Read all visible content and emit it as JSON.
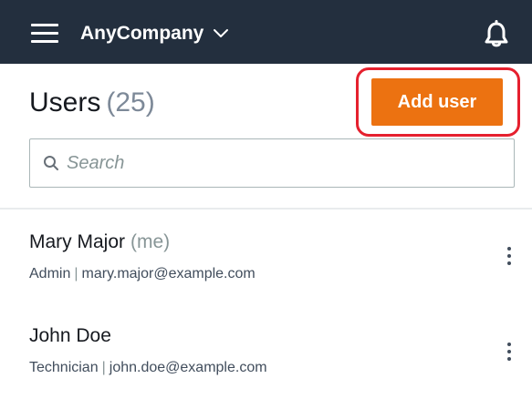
{
  "topbar": {
    "company_name": "AnyCompany",
    "menu_icon": "hamburger-menu-icon",
    "dropdown_icon": "chevron-down-icon",
    "notification_icon": "bell-icon",
    "background_color": "#232f3e"
  },
  "users_header": {
    "title": "Users",
    "count": "(25)",
    "add_button_label": "Add user",
    "add_button_color": "#ec7211",
    "highlight_color": "#e5202e"
  },
  "search": {
    "placeholder": "Search",
    "value": "",
    "icon": "search-icon"
  },
  "users": [
    {
      "name": "Mary Major",
      "tag": "(me)",
      "role": "Admin",
      "separator": "|",
      "email": "mary.major@example.com",
      "actions_icon": "more-vertical-icon"
    },
    {
      "name": "John Doe",
      "tag": "",
      "role": "Technician",
      "separator": "|",
      "email": "john.doe@example.com",
      "actions_icon": "more-vertical-icon"
    }
  ]
}
